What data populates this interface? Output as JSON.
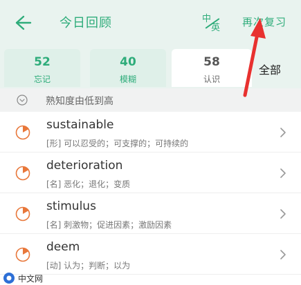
{
  "header": {
    "title": "今日回顾",
    "lang_top": "中",
    "lang_bottom": "英",
    "review_again": "再次复习"
  },
  "tabs": [
    {
      "count": "52",
      "label": "忘记"
    },
    {
      "count": "40",
      "label": "模糊"
    },
    {
      "count": "58",
      "label": "认识"
    }
  ],
  "tab_all": "全部",
  "sort": {
    "label": "熟知度由低到高"
  },
  "words": [
    {
      "word": "sustainable",
      "definition": "[形] 可以忍受的；可支撑的；可持续的"
    },
    {
      "word": "deterioration",
      "definition": "[名] 恶化；退化；变质"
    },
    {
      "word": "stimulus",
      "definition": "[名] 刺激物；促进因素；激励因素"
    },
    {
      "word": "deem",
      "definition": "[动] 认为；判断；以为"
    }
  ],
  "watermark": {
    "text": "中文网"
  },
  "colors": {
    "accent": "#2eac7a",
    "progress": "#e8773a",
    "annotation": "#e8312f"
  }
}
